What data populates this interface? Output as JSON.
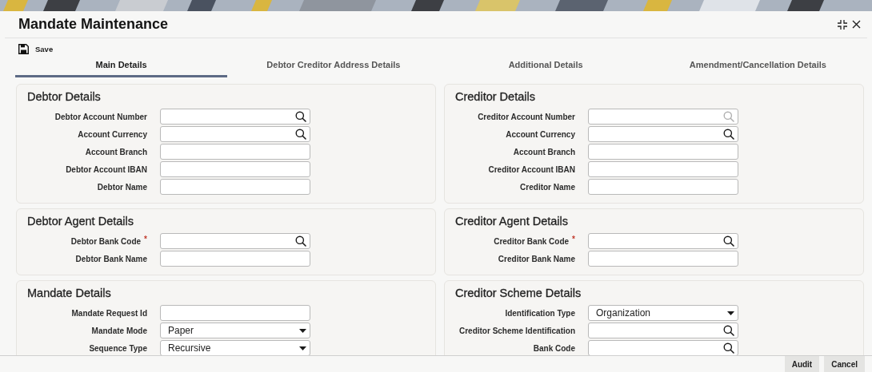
{
  "window": {
    "title": "Mandate Maintenance"
  },
  "toolbar": {
    "save": "Save"
  },
  "tabs": [
    {
      "label": "Main Details",
      "selected": true
    },
    {
      "label": "Debtor Creditor Address Details",
      "selected": false
    },
    {
      "label": "Additional Details",
      "selected": false
    },
    {
      "label": "Amendment/Cancellation Details",
      "selected": false
    }
  ],
  "sections": [
    {
      "title": "Debtor Details",
      "fields": [
        {
          "label": "Debtor Account Number",
          "kind": "search",
          "disabled": false
        },
        {
          "label": "Account Currency",
          "kind": "search",
          "disabled": false
        },
        {
          "label": "Account Branch",
          "kind": "text",
          "disabled": false
        },
        {
          "label": "Debtor Account IBAN",
          "kind": "text",
          "disabled": false
        },
        {
          "label": "Debtor Name",
          "kind": "text",
          "disabled": false
        }
      ]
    },
    {
      "title": "Creditor Details",
      "fields": [
        {
          "label": "Creditor Account Number",
          "kind": "search",
          "disabled": true
        },
        {
          "label": "Account Currency",
          "kind": "search",
          "disabled": false
        },
        {
          "label": "Account Branch",
          "kind": "text",
          "disabled": false
        },
        {
          "label": "Creditor Account IBAN",
          "kind": "text",
          "disabled": false
        },
        {
          "label": "Creditor Name",
          "kind": "text",
          "disabled": false
        }
      ]
    },
    {
      "title": "Debtor Agent Details",
      "fields": [
        {
          "label": "Debtor Bank Code",
          "required_mark": "*",
          "kind": "search",
          "disabled": false
        },
        {
          "label": "Debtor Bank Name",
          "kind": "text",
          "disabled": false
        }
      ]
    },
    {
      "title": "Creditor Agent Details",
      "fields": [
        {
          "label": "Creditor Bank Code",
          "required_mark": "*",
          "kind": "search",
          "disabled": false
        },
        {
          "label": "Creditor Bank Name",
          "kind": "text",
          "disabled": false
        }
      ]
    },
    {
      "title": "Mandate Details",
      "fields": [
        {
          "label": "Mandate Request Id",
          "kind": "text",
          "disabled": false
        },
        {
          "label": "Mandate Mode",
          "kind": "select",
          "value": "Paper",
          "disabled": false
        },
        {
          "label": "Sequence Type",
          "kind": "select",
          "value": "Recursive",
          "disabled": false
        }
      ]
    },
    {
      "title": "Creditor Scheme Details",
      "fields": [
        {
          "label": "Identification Type",
          "kind": "select",
          "value": "Organization",
          "disabled": false
        },
        {
          "label": "Creditor Scheme Identification",
          "kind": "search",
          "disabled": false
        },
        {
          "label": "Bank Code",
          "kind": "search",
          "disabled": false
        }
      ]
    }
  ],
  "footer_buttons": [
    "Audit",
    "Cancel"
  ]
}
